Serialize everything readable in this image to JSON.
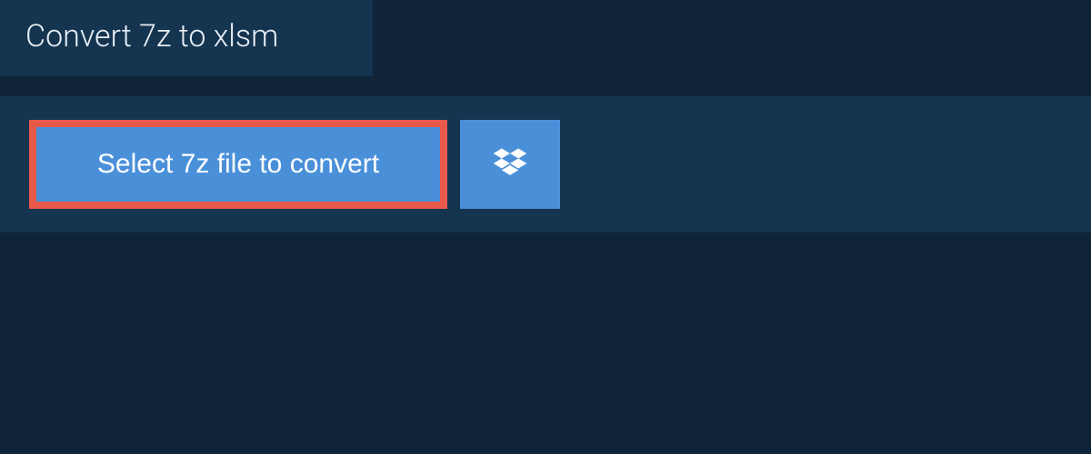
{
  "header": {
    "title": "Convert 7z to xlsm"
  },
  "actions": {
    "select_file_label": "Select 7z file to convert",
    "dropbox_icon": "dropbox-icon"
  },
  "colors": {
    "bg": "#0f2438",
    "panel": "#14344f",
    "button": "#4a90d9",
    "highlight_border": "#e75a49",
    "text": "#ffffff"
  }
}
